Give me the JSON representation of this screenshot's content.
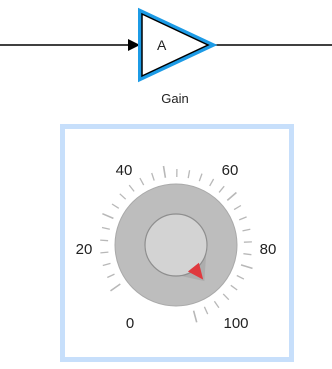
{
  "gain_block": {
    "input_letter": "A",
    "label": "Gain",
    "highlight_color": "#1c9be6"
  },
  "knob": {
    "tick_labels": [
      "0",
      "20",
      "40",
      "60",
      "80",
      "100"
    ],
    "range": [
      0,
      100
    ],
    "value": 92,
    "frame_color": "#c7dffb",
    "pointer_color": "#e0393e"
  }
}
